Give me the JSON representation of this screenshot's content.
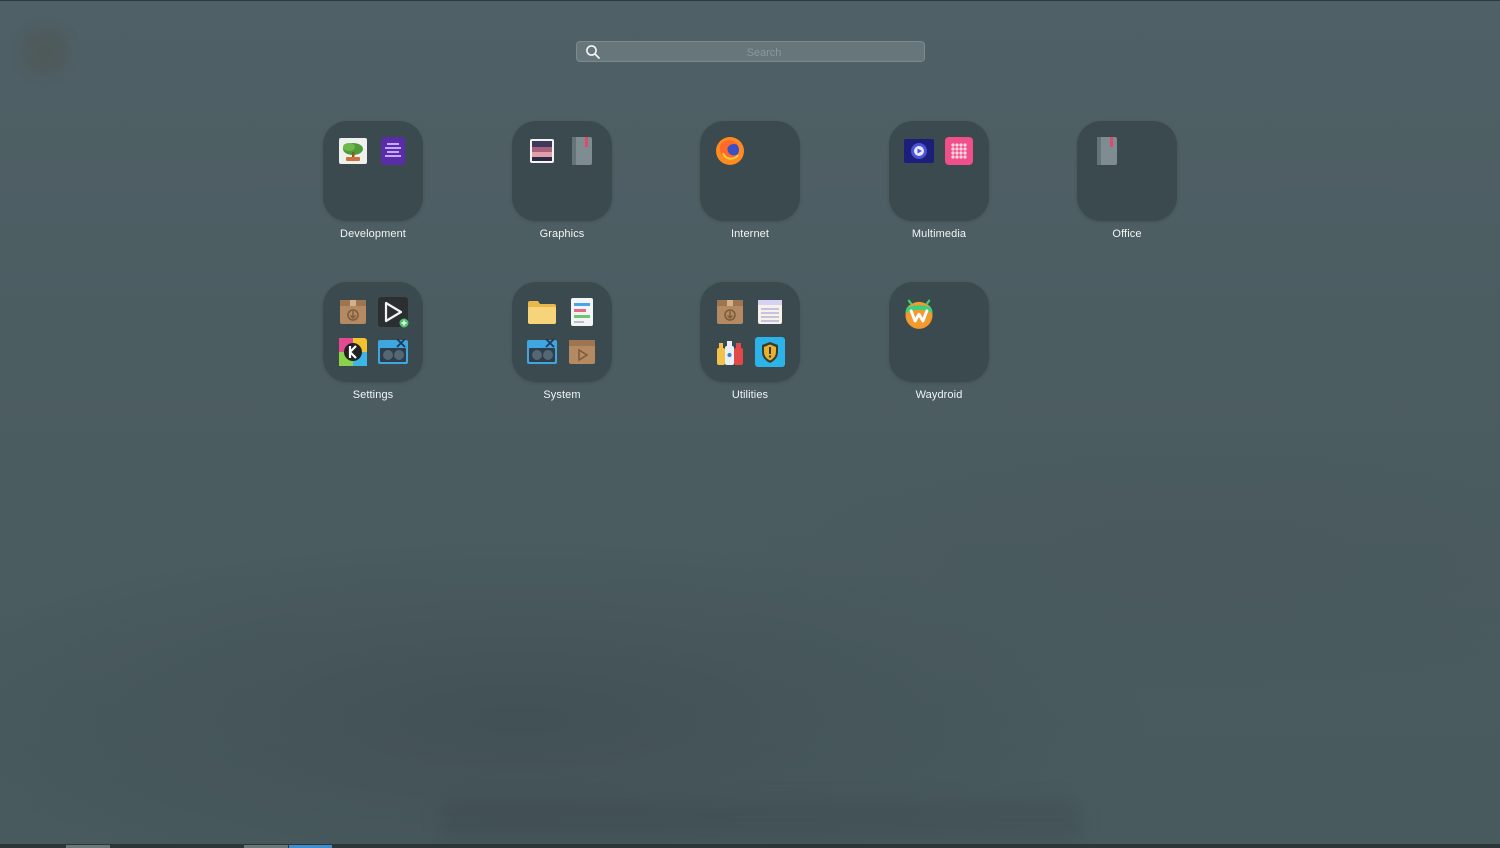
{
  "search": {
    "placeholder": "Search",
    "value": ""
  },
  "folders": [
    {
      "name": "Development",
      "icons": [
        "bonsai-icon",
        "text-app-icon"
      ]
    },
    {
      "name": "Graphics",
      "icons": [
        "image-viewer-icon",
        "notebook-icon"
      ]
    },
    {
      "name": "Internet",
      "icons": [
        "firefox-icon"
      ]
    },
    {
      "name": "Multimedia",
      "icons": [
        "video-player-icon",
        "pink-grid-app-icon"
      ]
    },
    {
      "name": "Office",
      "icons": [
        "notebook-icon"
      ]
    },
    {
      "name": "Settings",
      "icons": [
        "package-icon",
        "play-add-icon",
        "k-color-icon",
        "gpu-settings-icon"
      ]
    },
    {
      "name": "System",
      "icons": [
        "folder-icon",
        "form-icon",
        "gpu-monitor-icon",
        "package-play-icon"
      ]
    },
    {
      "name": "Utilities",
      "icons": [
        "package-icon",
        "notepad-icon",
        "bottles-icon",
        "shield-icon"
      ]
    },
    {
      "name": "Waydroid",
      "icons": [
        "waydroid-icon"
      ]
    }
  ],
  "colors": {
    "tile": "#3b4a4f",
    "background": "#4c5d62",
    "label": "#f2f5f6",
    "taskbar_active": "#3d8fd1"
  }
}
